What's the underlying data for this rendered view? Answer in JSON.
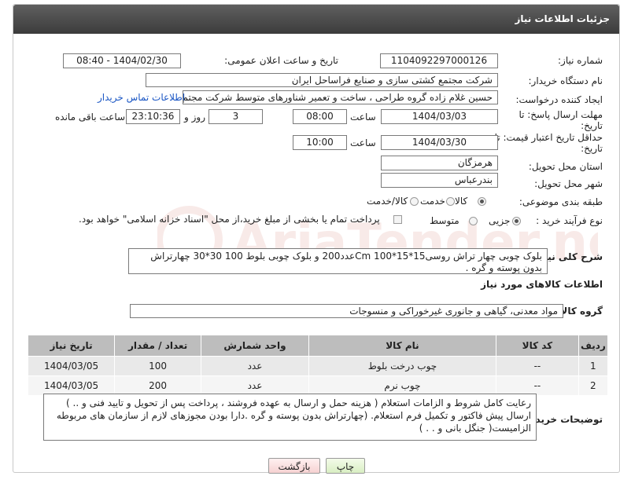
{
  "header": {
    "title": "جزئیات اطلاعات نیاز"
  },
  "fields": {
    "need_number": {
      "label": "شماره نیاز:",
      "value": "1104092297000126"
    },
    "announce_datetime": {
      "label": "تاریخ و ساعت اعلان عمومی:",
      "value": "1404/02/30 - 08:40"
    },
    "buyer_org": {
      "label": "نام دستگاه خریدار:",
      "value": "شرکت مجتمع کشتی سازی و صنایع فراساحل ایران"
    },
    "requester": {
      "label": "ایجاد کننده درخواست:",
      "value": "حسین  غلام زاده گروه طراحی ، ساخت و تعمیر شناورهای متوسط شرکت مجتم",
      "contact_link": "اطلاعات تماس خریدار"
    },
    "reply_deadline": {
      "label": "مهلت ارسال پاسخ: تا تاریخ:",
      "date": "1404/03/03",
      "time_label": "ساعت",
      "time": "08:00",
      "days": "3",
      "days_label": "روز و",
      "remaining": "23:10:36",
      "remaining_label": "ساعت باقی مانده"
    },
    "price_validity": {
      "label": "حداقل تاریخ اعتبار قیمت: تا تاریخ:",
      "date": "1404/03/30",
      "time_label": "ساعت",
      "time": "10:00"
    },
    "province": {
      "label": "استان محل تحویل:",
      "value": "هرمزگان"
    },
    "city": {
      "label": "شهر محل تحویل:",
      "value": "بندرعباس"
    },
    "category": {
      "label": "طبقه بندی موضوعی:",
      "options": [
        "کالا",
        "خدمت",
        "کالا/خدمت"
      ]
    },
    "process_type": {
      "label": "نوع فرآیند خرید :",
      "options": [
        "جزیی",
        "متوسط"
      ],
      "note": "پرداخت تمام یا بخشی از مبلغ خرید،از محل \"اسناد خزانه اسلامی\" خواهد بود."
    },
    "summary": {
      "label": "شرح کلی نیاز:",
      "value": "بلوک چوبی چهار تراش روسی15*15*Cm 100عدد200  و بلوک چوبی بلوط 100 30*30 چهارتراش بدون پوسته و گره ."
    }
  },
  "goods_section": {
    "title": "اطلاعات کالاهای مورد نیاز",
    "group_label": "گروه کالا:",
    "group_value": "مواد معدنی، گیاهی و جانوری غیرخوراکی و منسوجات"
  },
  "table": {
    "headers": [
      "ردیف",
      "کد کالا",
      "نام کالا",
      "واحد شمارش",
      "تعداد / مقدار",
      "تاریخ نیاز"
    ],
    "rows": [
      [
        "1",
        "--",
        "چوب درخت بلوط",
        "عدد",
        "100",
        "1404/03/05"
      ],
      [
        "2",
        "--",
        "چوب نرم",
        "عدد",
        "200",
        "1404/03/05"
      ]
    ]
  },
  "buyer_notes": {
    "label": "توضیحات خریدار:",
    "value": "رعایت کامل شروط و الزامات استعلام ( هزینه حمل و ارسال  به عهده فروشند ، پرداخت  پس از تحویل و تایید فنی و .. )  ارسال  پیش فاکتور و تکمیل فرم استعلام. (چهارتراش بدون پوسته و گره .دارا بودن مجوزهای لازم از سازمان های مربوطه الزامیست( جنگل بانی و . . )"
  },
  "buttons": {
    "print": "چاپ",
    "back": "بازگشت"
  },
  "watermark": {
    "text": "AriaTender.neT"
  }
}
